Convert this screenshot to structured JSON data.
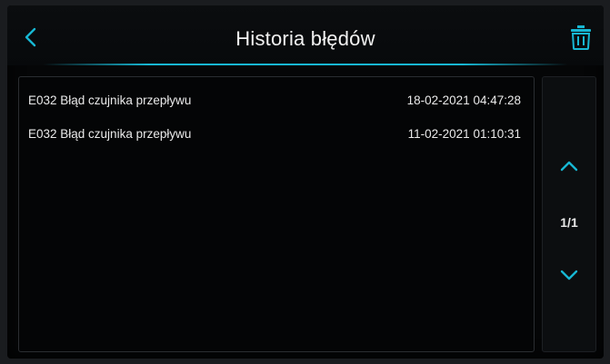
{
  "header": {
    "title": "Historia błędów",
    "back_icon": "chevron-left-icon",
    "trash_icon": "trash-icon"
  },
  "errors": [
    {
      "message": "E032 Błąd czujnika przepływu",
      "timestamp": "18-02-2021 04:47:28"
    },
    {
      "message": "E032 Błąd czujnika przepływu",
      "timestamp": "11-02-2021 01:10:31"
    }
  ],
  "pagination": {
    "page": "1/1",
    "up_icon": "chevron-up-icon",
    "down_icon": "chevron-down-icon"
  },
  "colors": {
    "accent": "#17b7d3",
    "background": "#050607",
    "text": "#eaeaea"
  }
}
